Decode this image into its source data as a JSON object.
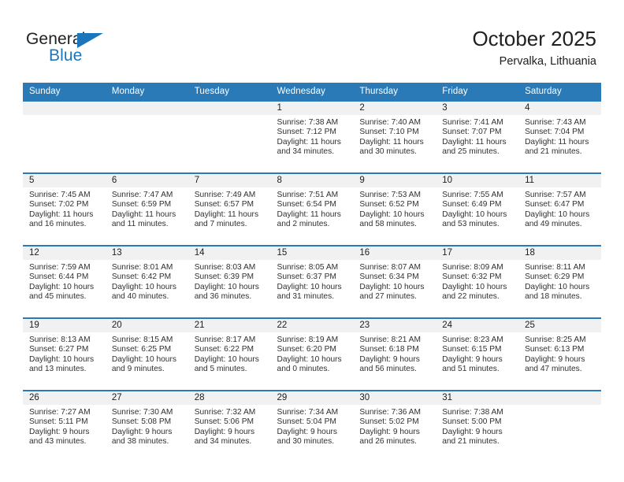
{
  "brand": {
    "word_one": "General",
    "word_two": "Blue",
    "triangle_icon": "brand-triangle-icon",
    "accent_color": "#1b76bc"
  },
  "header": {
    "title": "October 2025",
    "subtitle": "Pervalka, Lithuania"
  },
  "theme": {
    "header_blue": "#2b7ab8",
    "daynum_gray": "#f1f1f1",
    "text": "#202020"
  },
  "weekday_headers": [
    "Sunday",
    "Monday",
    "Tuesday",
    "Wednesday",
    "Thursday",
    "Friday",
    "Saturday"
  ],
  "labels": {
    "sunrise_prefix": "Sunrise:",
    "sunset_prefix": "Sunset:",
    "daylight_prefix": "Daylight:"
  },
  "weeks": [
    [
      {
        "day": "",
        "sunrise": "",
        "sunset": "",
        "daylight_line1": "",
        "daylight_line2": ""
      },
      {
        "day": "",
        "sunrise": "",
        "sunset": "",
        "daylight_line1": "",
        "daylight_line2": ""
      },
      {
        "day": "",
        "sunrise": "",
        "sunset": "",
        "daylight_line1": "",
        "daylight_line2": ""
      },
      {
        "day": "1",
        "sunrise": "Sunrise: 7:38 AM",
        "sunset": "Sunset: 7:12 PM",
        "daylight_line1": "Daylight: 11 hours",
        "daylight_line2": "and 34 minutes."
      },
      {
        "day": "2",
        "sunrise": "Sunrise: 7:40 AM",
        "sunset": "Sunset: 7:10 PM",
        "daylight_line1": "Daylight: 11 hours",
        "daylight_line2": "and 30 minutes."
      },
      {
        "day": "3",
        "sunrise": "Sunrise: 7:41 AM",
        "sunset": "Sunset: 7:07 PM",
        "daylight_line1": "Daylight: 11 hours",
        "daylight_line2": "and 25 minutes."
      },
      {
        "day": "4",
        "sunrise": "Sunrise: 7:43 AM",
        "sunset": "Sunset: 7:04 PM",
        "daylight_line1": "Daylight: 11 hours",
        "daylight_line2": "and 21 minutes."
      }
    ],
    [
      {
        "day": "5",
        "sunrise": "Sunrise: 7:45 AM",
        "sunset": "Sunset: 7:02 PM",
        "daylight_line1": "Daylight: 11 hours",
        "daylight_line2": "and 16 minutes."
      },
      {
        "day": "6",
        "sunrise": "Sunrise: 7:47 AM",
        "sunset": "Sunset: 6:59 PM",
        "daylight_line1": "Daylight: 11 hours",
        "daylight_line2": "and 11 minutes."
      },
      {
        "day": "7",
        "sunrise": "Sunrise: 7:49 AM",
        "sunset": "Sunset: 6:57 PM",
        "daylight_line1": "Daylight: 11 hours",
        "daylight_line2": "and 7 minutes."
      },
      {
        "day": "8",
        "sunrise": "Sunrise: 7:51 AM",
        "sunset": "Sunset: 6:54 PM",
        "daylight_line1": "Daylight: 11 hours",
        "daylight_line2": "and 2 minutes."
      },
      {
        "day": "9",
        "sunrise": "Sunrise: 7:53 AM",
        "sunset": "Sunset: 6:52 PM",
        "daylight_line1": "Daylight: 10 hours",
        "daylight_line2": "and 58 minutes."
      },
      {
        "day": "10",
        "sunrise": "Sunrise: 7:55 AM",
        "sunset": "Sunset: 6:49 PM",
        "daylight_line1": "Daylight: 10 hours",
        "daylight_line2": "and 53 minutes."
      },
      {
        "day": "11",
        "sunrise": "Sunrise: 7:57 AM",
        "sunset": "Sunset: 6:47 PM",
        "daylight_line1": "Daylight: 10 hours",
        "daylight_line2": "and 49 minutes."
      }
    ],
    [
      {
        "day": "12",
        "sunrise": "Sunrise: 7:59 AM",
        "sunset": "Sunset: 6:44 PM",
        "daylight_line1": "Daylight: 10 hours",
        "daylight_line2": "and 45 minutes."
      },
      {
        "day": "13",
        "sunrise": "Sunrise: 8:01 AM",
        "sunset": "Sunset: 6:42 PM",
        "daylight_line1": "Daylight: 10 hours",
        "daylight_line2": "and 40 minutes."
      },
      {
        "day": "14",
        "sunrise": "Sunrise: 8:03 AM",
        "sunset": "Sunset: 6:39 PM",
        "daylight_line1": "Daylight: 10 hours",
        "daylight_line2": "and 36 minutes."
      },
      {
        "day": "15",
        "sunrise": "Sunrise: 8:05 AM",
        "sunset": "Sunset: 6:37 PM",
        "daylight_line1": "Daylight: 10 hours",
        "daylight_line2": "and 31 minutes."
      },
      {
        "day": "16",
        "sunrise": "Sunrise: 8:07 AM",
        "sunset": "Sunset: 6:34 PM",
        "daylight_line1": "Daylight: 10 hours",
        "daylight_line2": "and 27 minutes."
      },
      {
        "day": "17",
        "sunrise": "Sunrise: 8:09 AM",
        "sunset": "Sunset: 6:32 PM",
        "daylight_line1": "Daylight: 10 hours",
        "daylight_line2": "and 22 minutes."
      },
      {
        "day": "18",
        "sunrise": "Sunrise: 8:11 AM",
        "sunset": "Sunset: 6:29 PM",
        "daylight_line1": "Daylight: 10 hours",
        "daylight_line2": "and 18 minutes."
      }
    ],
    [
      {
        "day": "19",
        "sunrise": "Sunrise: 8:13 AM",
        "sunset": "Sunset: 6:27 PM",
        "daylight_line1": "Daylight: 10 hours",
        "daylight_line2": "and 13 minutes."
      },
      {
        "day": "20",
        "sunrise": "Sunrise: 8:15 AM",
        "sunset": "Sunset: 6:25 PM",
        "daylight_line1": "Daylight: 10 hours",
        "daylight_line2": "and 9 minutes."
      },
      {
        "day": "21",
        "sunrise": "Sunrise: 8:17 AM",
        "sunset": "Sunset: 6:22 PM",
        "daylight_line1": "Daylight: 10 hours",
        "daylight_line2": "and 5 minutes."
      },
      {
        "day": "22",
        "sunrise": "Sunrise: 8:19 AM",
        "sunset": "Sunset: 6:20 PM",
        "daylight_line1": "Daylight: 10 hours",
        "daylight_line2": "and 0 minutes."
      },
      {
        "day": "23",
        "sunrise": "Sunrise: 8:21 AM",
        "sunset": "Sunset: 6:18 PM",
        "daylight_line1": "Daylight: 9 hours",
        "daylight_line2": "and 56 minutes."
      },
      {
        "day": "24",
        "sunrise": "Sunrise: 8:23 AM",
        "sunset": "Sunset: 6:15 PM",
        "daylight_line1": "Daylight: 9 hours",
        "daylight_line2": "and 51 minutes."
      },
      {
        "day": "25",
        "sunrise": "Sunrise: 8:25 AM",
        "sunset": "Sunset: 6:13 PM",
        "daylight_line1": "Daylight: 9 hours",
        "daylight_line2": "and 47 minutes."
      }
    ],
    [
      {
        "day": "26",
        "sunrise": "Sunrise: 7:27 AM",
        "sunset": "Sunset: 5:11 PM",
        "daylight_line1": "Daylight: 9 hours",
        "daylight_line2": "and 43 minutes."
      },
      {
        "day": "27",
        "sunrise": "Sunrise: 7:30 AM",
        "sunset": "Sunset: 5:08 PM",
        "daylight_line1": "Daylight: 9 hours",
        "daylight_line2": "and 38 minutes."
      },
      {
        "day": "28",
        "sunrise": "Sunrise: 7:32 AM",
        "sunset": "Sunset: 5:06 PM",
        "daylight_line1": "Daylight: 9 hours",
        "daylight_line2": "and 34 minutes."
      },
      {
        "day": "29",
        "sunrise": "Sunrise: 7:34 AM",
        "sunset": "Sunset: 5:04 PM",
        "daylight_line1": "Daylight: 9 hours",
        "daylight_line2": "and 30 minutes."
      },
      {
        "day": "30",
        "sunrise": "Sunrise: 7:36 AM",
        "sunset": "Sunset: 5:02 PM",
        "daylight_line1": "Daylight: 9 hours",
        "daylight_line2": "and 26 minutes."
      },
      {
        "day": "31",
        "sunrise": "Sunrise: 7:38 AM",
        "sunset": "Sunset: 5:00 PM",
        "daylight_line1": "Daylight: 9 hours",
        "daylight_line2": "and 21 minutes."
      },
      {
        "day": "",
        "sunrise": "",
        "sunset": "",
        "daylight_line1": "",
        "daylight_line2": ""
      }
    ]
  ]
}
